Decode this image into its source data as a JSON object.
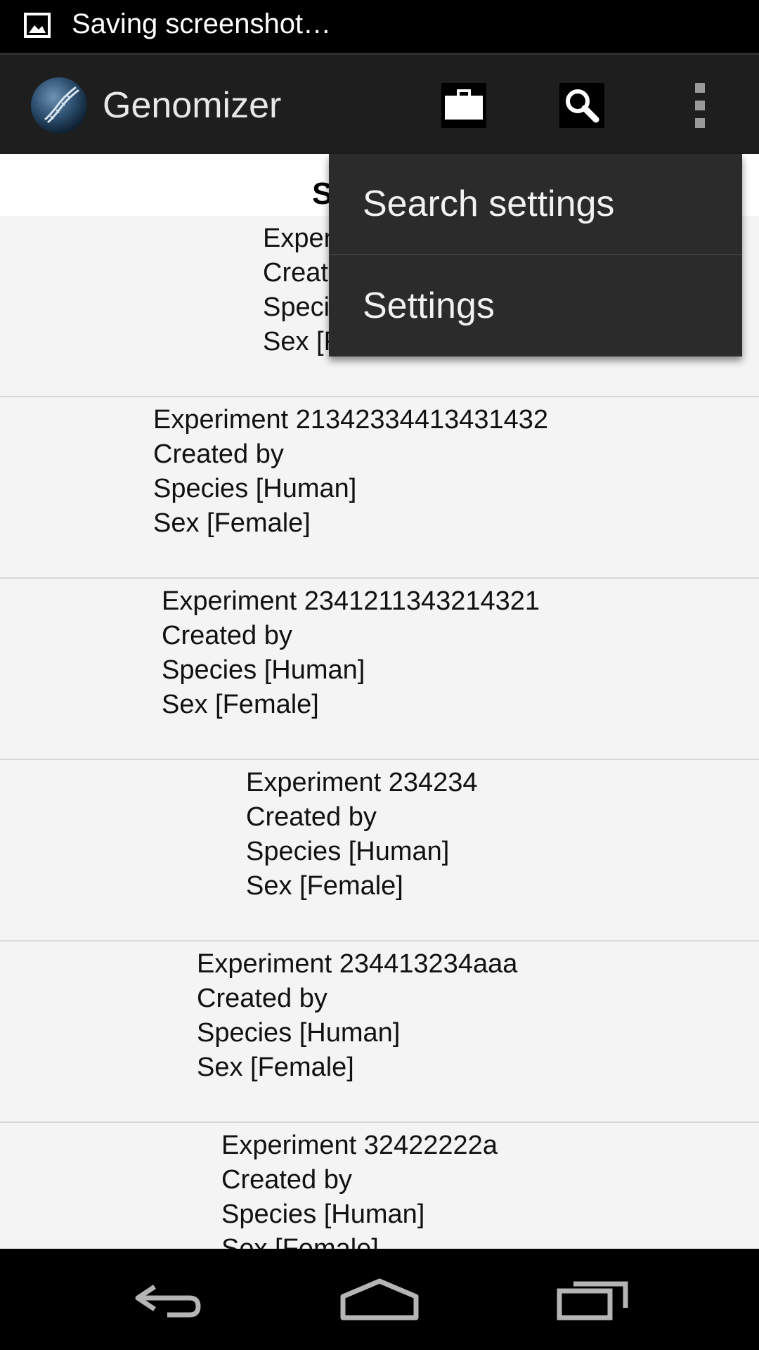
{
  "status_bar": {
    "text": "Saving screenshot…",
    "icon": "image-icon"
  },
  "action_bar": {
    "title": "Genomizer",
    "logo": "dna-globe-logo",
    "buttons": [
      "briefcase-icon",
      "search-icon",
      "overflow-menu-icon"
    ]
  },
  "header": {
    "label": "SEARCH"
  },
  "results": [
    {
      "line1": "Experiment",
      "line2": "Created by",
      "line3": "Species [Human]",
      "line4": "Sex [Female]"
    },
    {
      "line1": "Experiment 21342334413431432",
      "line2": "Created by",
      "line3": "Species [Human]",
      "line4": "Sex [Female]"
    },
    {
      "line1": "Experiment 2341211343214321",
      "line2": "Created by",
      "line3": "Species [Human]",
      "line4": "Sex [Female]"
    },
    {
      "line1": "Experiment 234234",
      "line2": "Created by",
      "line3": "Species [Human]",
      "line4": "Sex [Female]"
    },
    {
      "line1": "Experiment 234413234aaa",
      "line2": "Created by",
      "line3": "Species [Human]",
      "line4": "Sex [Female]"
    },
    {
      "line1": "Experiment 32422222a",
      "line2": "Created by",
      "line3": "Species [Human]",
      "line4": "Sex [Female]"
    }
  ],
  "overflow_menu": {
    "items": [
      "Search settings",
      "Settings"
    ]
  },
  "nav_bar": {
    "buttons": [
      "back-icon",
      "home-icon",
      "recent-apps-icon"
    ]
  },
  "colors": {
    "status_bar": "#000000",
    "action_bar": "#1e1e1e",
    "menu": "#2b2b2b",
    "content_bg": "#f4f4f4",
    "divider": "#d8d8d8"
  }
}
